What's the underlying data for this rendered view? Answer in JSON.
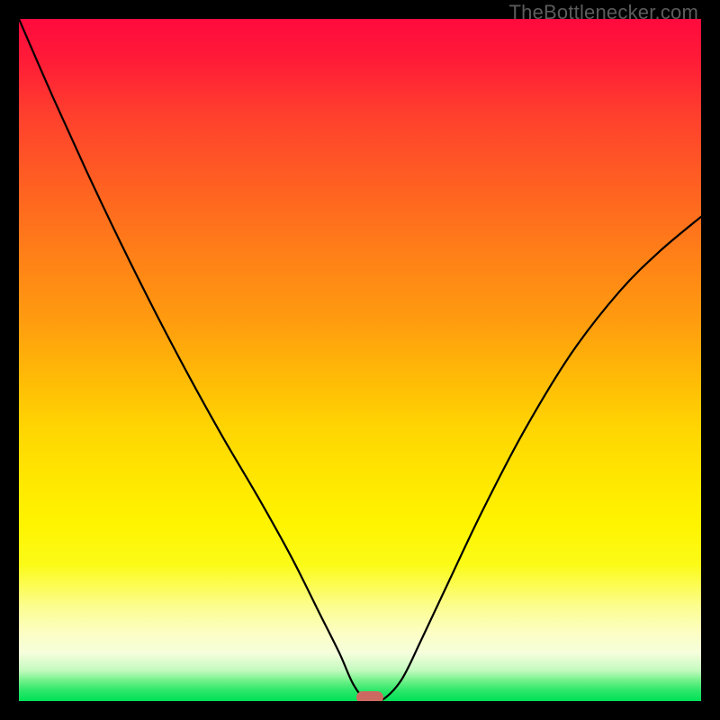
{
  "watermark": {
    "text": "TheBottlenecker.com"
  },
  "colors": {
    "frame": "#000000",
    "curve": "#000000",
    "marker": "#cc6a62",
    "gradient_top": "#ff0a3e",
    "gradient_bottom": "#00e057"
  },
  "chart_data": {
    "type": "line",
    "title": "",
    "xlabel": "",
    "ylabel": "",
    "xlim": [
      0,
      1
    ],
    "ylim": [
      0,
      1
    ],
    "series": [
      {
        "name": "bottleneck-curve",
        "x": [
          0.0,
          0.05,
          0.1,
          0.15,
          0.2,
          0.25,
          0.3,
          0.35,
          0.4,
          0.44,
          0.47,
          0.49,
          0.51,
          0.53,
          0.56,
          0.59,
          0.63,
          0.68,
          0.74,
          0.81,
          0.88,
          0.94,
          1.0
        ],
        "y": [
          1.0,
          0.885,
          0.775,
          0.67,
          0.57,
          0.475,
          0.385,
          0.3,
          0.21,
          0.13,
          0.07,
          0.025,
          0.0,
          0.0,
          0.03,
          0.09,
          0.175,
          0.28,
          0.395,
          0.51,
          0.6,
          0.66,
          0.71
        ]
      }
    ],
    "marker": {
      "x": 0.515,
      "y": 0.005
    },
    "annotations": [
      {
        "text": "TheBottlenecker.com",
        "position": "top-right"
      }
    ]
  }
}
